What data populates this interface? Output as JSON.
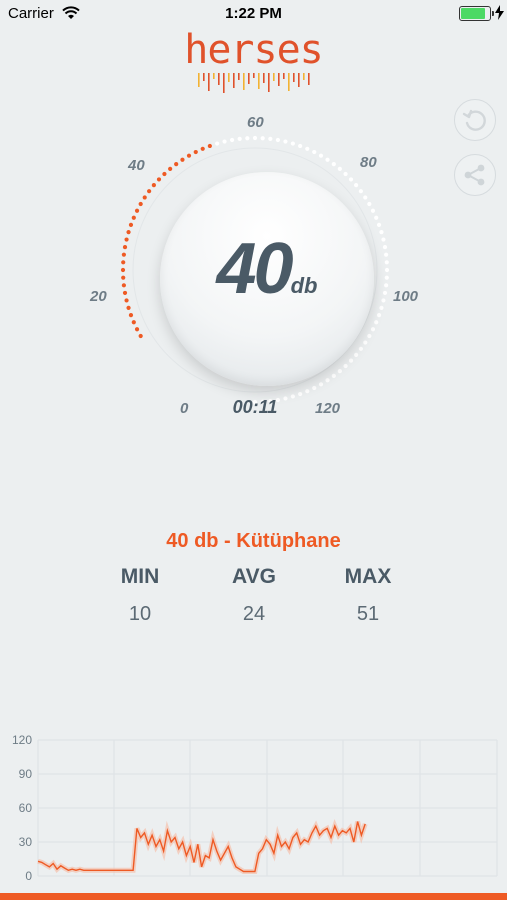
{
  "status_bar": {
    "carrier": "Carrier",
    "time": "1:22 PM"
  },
  "app": {
    "logo": "herses"
  },
  "gauge": {
    "scale_labels": [
      "0",
      "20",
      "40",
      "60",
      "80",
      "100",
      "120"
    ],
    "reading_value": "40",
    "reading_unit": "db",
    "timer": "00:11",
    "level": 40,
    "scale_max": 120
  },
  "summary": {
    "level_text": "40 db - Kütüphane",
    "min_label": "MIN",
    "min_value": "10",
    "avg_label": "AVG",
    "avg_value": "24",
    "max_label": "MAX",
    "max_value": "51"
  },
  "icons": {
    "refresh": "refresh-icon",
    "share": "share-icon",
    "wifi": "wifi-icon",
    "battery": "battery-icon"
  },
  "colors": {
    "accent": "#ee5a24",
    "text": "#4a5a66",
    "background": "#eceff0"
  },
  "chart_data": {
    "type": "line",
    "y_ticks": [
      "120",
      "90",
      "60",
      "30",
      "0"
    ],
    "ylim": [
      0,
      120
    ],
    "xlim": [
      0,
      76
    ],
    "grid": true,
    "series": [
      {
        "values": [
          13,
          12,
          10,
          8,
          11,
          6,
          9,
          7,
          5,
          6,
          5,
          6,
          5,
          5,
          5,
          5,
          5,
          5,
          5,
          5,
          5,
          5,
          5,
          5,
          5,
          5,
          42,
          34,
          38,
          28,
          36,
          26,
          32,
          22,
          40,
          30,
          34,
          24,
          30,
          18,
          26,
          12,
          28,
          8,
          18,
          16,
          32,
          22,
          14,
          20,
          26,
          16,
          8,
          6,
          4,
          4,
          4,
          4,
          20,
          24,
          32,
          28,
          20,
          36,
          26,
          30,
          24,
          34,
          38,
          28,
          32,
          30,
          38,
          44,
          36,
          40,
          42,
          34,
          44,
          36,
          40,
          38,
          42,
          30,
          48,
          36,
          46
        ]
      }
    ]
  }
}
